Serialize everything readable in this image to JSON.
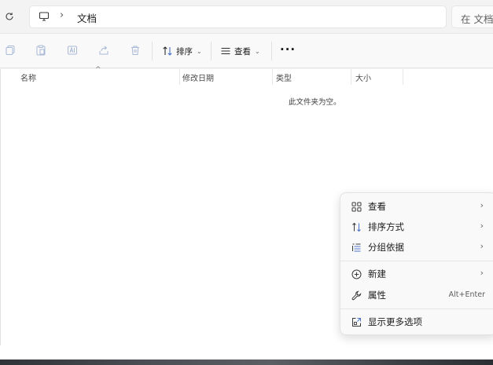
{
  "address": {
    "path_label": "文档",
    "search_placeholder": "在 文档"
  },
  "toolbar": {
    "sort_label": "排序",
    "view_label": "查看",
    "more_label": "···"
  },
  "columns": {
    "name": "名称",
    "date": "修改日期",
    "type": "类型",
    "size": "大小"
  },
  "empty_message": "此文件夹为空。",
  "context_menu": {
    "items": [
      {
        "label": "查看",
        "icon": "grid-view-icon",
        "has_submenu": true
      },
      {
        "label": "排序方式",
        "icon": "sort-icon",
        "has_submenu": true
      },
      {
        "label": "分组依据",
        "icon": "group-list-icon",
        "has_submenu": true
      },
      {
        "label": "新建",
        "icon": "add-circle-icon",
        "has_submenu": true
      },
      {
        "label": "属性",
        "icon": "wrench-icon",
        "shortcut": "Alt+Enter"
      },
      {
        "label": "显示更多选项",
        "icon": "open-external-icon"
      }
    ]
  },
  "colors": {
    "window_bg": "#f3f3f3",
    "toolbar_bg": "#f9f9f9",
    "content_bg": "#ffffff",
    "accent": "#4a73c9",
    "disabled_icon": "#a9b9d6"
  }
}
